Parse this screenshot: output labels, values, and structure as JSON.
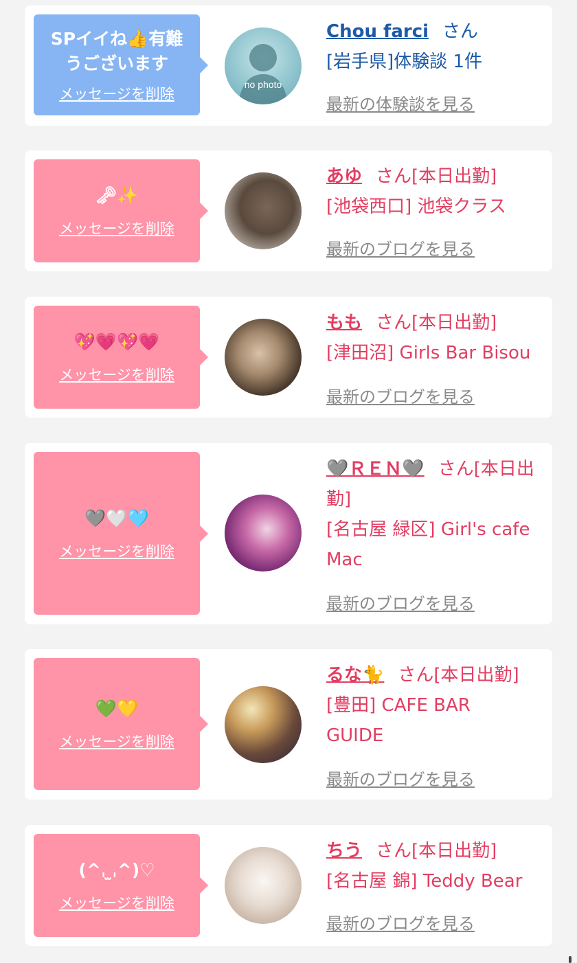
{
  "messages": [
    {
      "greeting": "SPイイね👍有難うございます",
      "delete_label": "メッセージを削除",
      "name": "Chou farci",
      "honorific": "さん",
      "info": "[岩手県]体験談 1件",
      "more_label": "最新の体験談を見る",
      "avatar_caption": "no photo",
      "accent": "#1d5aa8"
    },
    {
      "greeting": "🗝✨",
      "delete_label": "メッセージを削除",
      "name": "あゆ",
      "honorific": "さん[本日出勤]",
      "info": "[池袋西口] 池袋クラス",
      "more_label": "最新のブログを見る",
      "accent": "#e23e62"
    },
    {
      "greeting": "💖💗💖💗",
      "delete_label": "メッセージを削除",
      "name": "もも",
      "honorific": "さん[本日出勤]",
      "info": "[津田沼] Girls Bar Bisou",
      "more_label": "最新のブログを見る",
      "accent": "#e23e62"
    },
    {
      "greeting": "🩶🤍🩵",
      "delete_label": "メッセージを削除",
      "name": "🩶ＲＥＮ🩶",
      "honorific": "さん[本日出勤]",
      "info": "[名古屋 緑区] Girl's cafe Mac",
      "more_label": "最新のブログを見る",
      "accent": "#e23e62"
    },
    {
      "greeting": "💚💛",
      "delete_label": "メッセージを削除",
      "name": "るな🐈",
      "honorific": "さん[本日出勤]",
      "info": "[豊田] CAFE BAR GUIDE",
      "more_label": "最新のブログを見る",
      "accent": "#e23e62"
    },
    {
      "greeting": "(^ˌ ̫ˌ^)♡",
      "delete_label": "メッセージを削除",
      "name": "ちう",
      "honorific": "さん[本日出勤]",
      "info": "[名古屋 錦] Teddy Bear",
      "more_label": "最新のブログを見る",
      "accent": "#e23e62"
    }
  ]
}
